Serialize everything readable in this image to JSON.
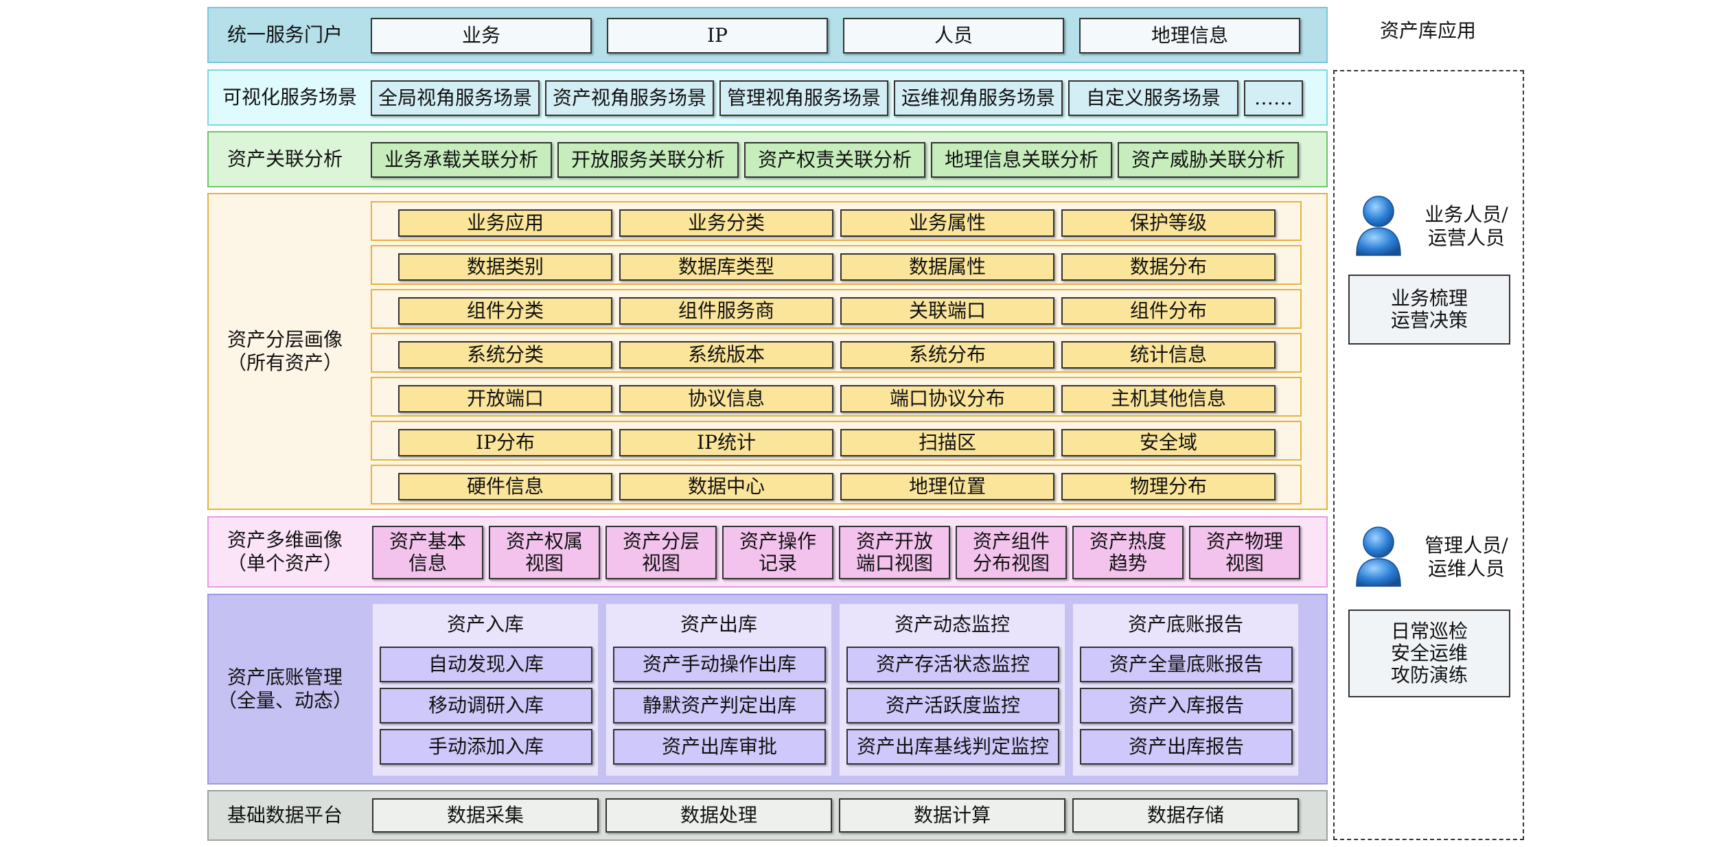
{
  "right_panel": {
    "title": "资产库应用",
    "group1": {
      "role_line1": "业务人员/",
      "role_line2": "运营人员",
      "box": "业务梳理\n运营决策"
    },
    "group2": {
      "role_line1": "管理人员/",
      "role_line2": "运维人员",
      "box": "日常巡检\n安全运维\n攻防演练"
    }
  },
  "layers": {
    "portal": {
      "label": "统一服务门户",
      "items": [
        "业务",
        "IP",
        "人员",
        "地理信息"
      ],
      "colors": {
        "bg": "#b5e0ea",
        "border": "#7cc6d8"
      }
    },
    "scenes": {
      "label": "可视化服务场景",
      "items": [
        "全局视角服务场景",
        "资产视角服务场景",
        "管理视角服务场景",
        "运维视角服务场景",
        "自定义服务场景",
        "……"
      ],
      "colors": {
        "bg": "#e0fbfd",
        "border": "#7ed6e6"
      }
    },
    "relation": {
      "label": "资产关联分析",
      "items": [
        "业务承载关联分析",
        "开放服务关联分析",
        "资产权责关联分析",
        "地理信息关联分析",
        "资产威胁关联分析"
      ],
      "colors": {
        "bg": "#dcf5d8",
        "border": "#6fc46a"
      }
    },
    "layered": {
      "label": "资产分层画像\n（所有资产）",
      "rows": [
        [
          "业务应用",
          "业务分类",
          "业务属性",
          "保护等级"
        ],
        [
          "数据类别",
          "数据库类型",
          "数据属性",
          "数据分布"
        ],
        [
          "组件分类",
          "组件服务商",
          "关联端口",
          "组件分布"
        ],
        [
          "系统分类",
          "系统版本",
          "系统分布",
          "统计信息"
        ],
        [
          "开放端口",
          "协议信息",
          "端口协议分布",
          "主机其他信息"
        ],
        [
          "IP分布",
          "IP统计",
          "扫描区",
          "安全域"
        ],
        [
          "硬件信息",
          "数据中心",
          "地理位置",
          "物理分布"
        ]
      ],
      "colors": {
        "bg": "#fdf5e6",
        "border": "#e8b23a",
        "item": "#fbe59a"
      }
    },
    "multi": {
      "label": "资产多维画像\n（单个资产）",
      "items": [
        "资产基本\n信息",
        "资产权属\n视图",
        "资产分层\n视图",
        "资产操作\n记录",
        "资产开放\n端口视图",
        "资产组件\n分布视图",
        "资产热度\n趋势",
        "资产物理\n视图"
      ],
      "colors": {
        "bg": "#fbe3f8",
        "border": "#e79be0",
        "item": "#f3c3ee"
      }
    },
    "ledger": {
      "label": "资产底账管理\n（全量、动态）",
      "groups": [
        {
          "title": "资产入库",
          "items": [
            "自动发现入库",
            "移动调研入库",
            "手动添加入库"
          ]
        },
        {
          "title": "资产出库",
          "items": [
            "资产手动操作出库",
            "静默资产判定出库",
            "资产出库审批"
          ]
        },
        {
          "title": "资产动态监控",
          "items": [
            "资产存活状态监控",
            "资产活跃度监控",
            "资产出库基线判定监控"
          ]
        },
        {
          "title": "资产底账报告",
          "items": [
            "资产全量底账报告",
            "资产入库报告",
            "资产出库报告"
          ]
        }
      ],
      "colors": {
        "bg": "#c6c1f3",
        "border": "#9f97e6",
        "item": "#cfc8fa"
      }
    },
    "base": {
      "label": "基础数据平台",
      "items": [
        "数据采集",
        "数据处理",
        "数据计算",
        "数据存储"
      ],
      "colors": {
        "bg": "#dadfdb",
        "border": "#9aa39c",
        "item": "#eef0ee"
      }
    }
  }
}
